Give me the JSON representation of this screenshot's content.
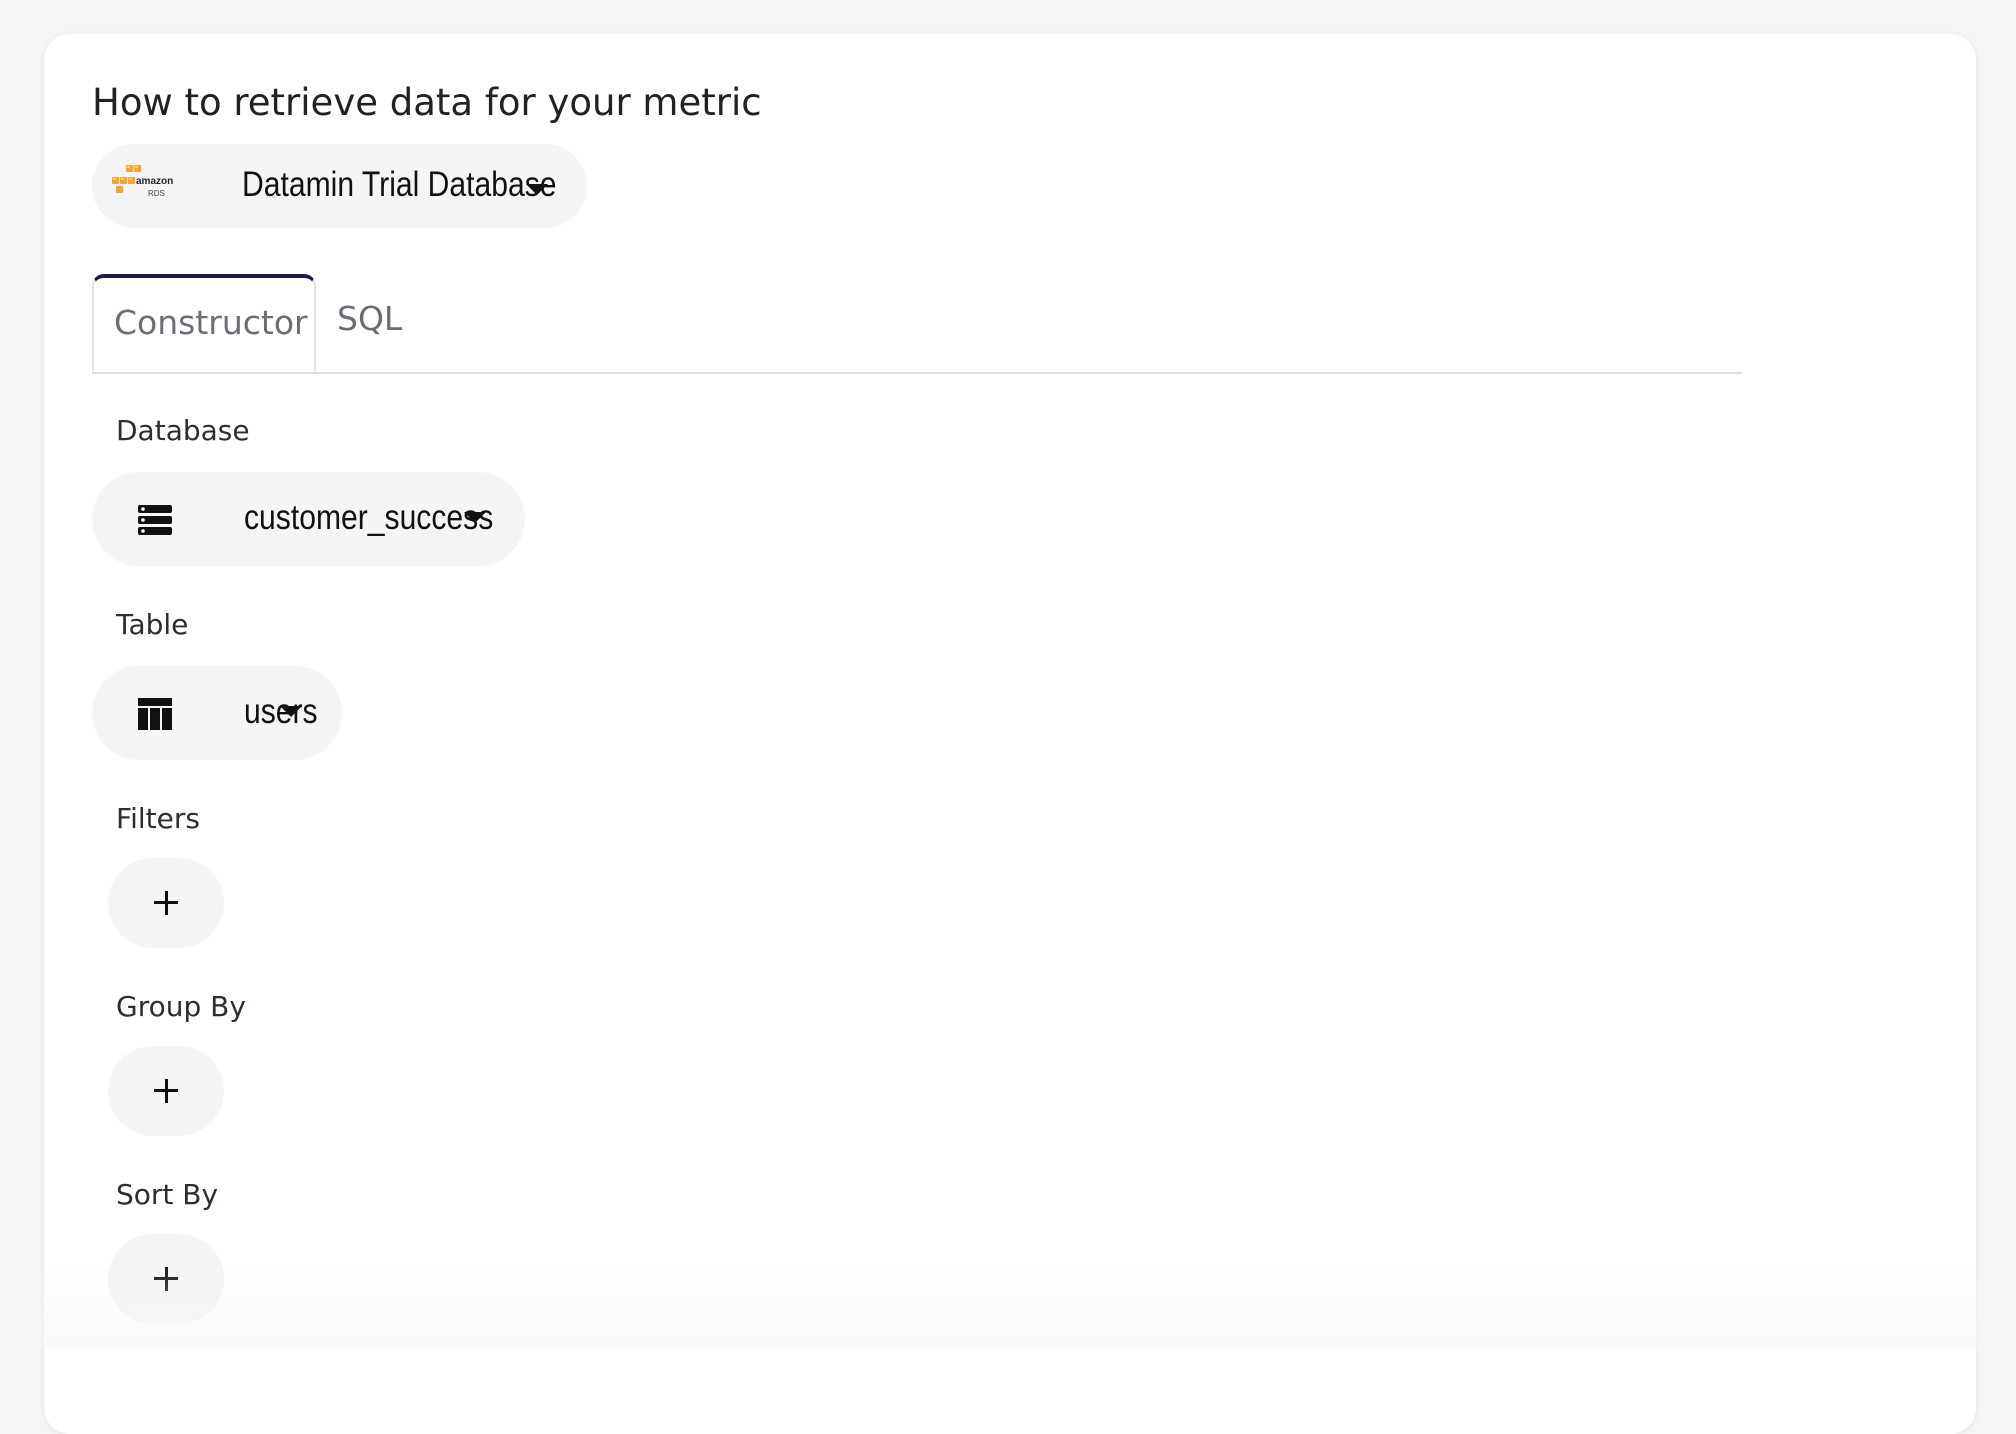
{
  "title": "How to retrieve data for your metric",
  "data_source": {
    "logo_icon": "amazon-rds-logo",
    "logo_text_top": "amazon",
    "logo_text_bottom": "RDS",
    "label": "Datamin Trial Database"
  },
  "tabs": [
    {
      "label": "Constructor",
      "active": true
    },
    {
      "label": "SQL",
      "active": false
    }
  ],
  "sections": {
    "database": {
      "label": "Database",
      "icon": "database-icon",
      "value": "customer_success"
    },
    "table": {
      "label": "Table",
      "icon": "table-icon",
      "value": "users"
    },
    "filters": {
      "label": "Filters",
      "button": "+"
    },
    "group_by": {
      "label": "Group By",
      "button": "+"
    },
    "sort_by": {
      "label": "Sort By",
      "button": "+"
    }
  },
  "colors": {
    "accent": "#1c1b4a",
    "pill_bg": "#f5f5f7",
    "rds_orange": "#f0a43a"
  }
}
